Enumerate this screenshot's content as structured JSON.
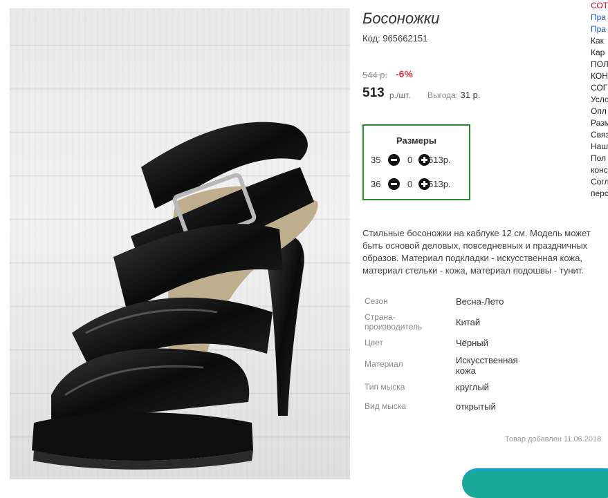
{
  "product": {
    "title": "Босоножки",
    "code_label": "Код: 965662151",
    "old_price": "544 р.",
    "discount": "-6%",
    "price": "513",
    "price_unit": "р./шт.",
    "saving_label": "Выгода:",
    "saving_value": "31 р."
  },
  "sizes": {
    "title": "Размеры",
    "rows": [
      {
        "size": "35",
        "qty": "0",
        "subtotal": "513р."
      },
      {
        "size": "36",
        "qty": "0",
        "subtotal": "513р."
      }
    ]
  },
  "description": [
    "Стильные босоножки на каблуке 12 см. Модель может",
    "быть основой деловых, повседневных и праздничных",
    "образов. Материал подкладки - искусственная кожа,",
    "материал стельки - кожа, материал подошвы - тунит."
  ],
  "attributes": [
    {
      "label": "Сезон",
      "value": "Весна-Лето"
    },
    {
      "label": "Страна-производитель",
      "value": "Китай"
    },
    {
      "label": "Цвет",
      "value": "Чёрный"
    },
    {
      "label": "Материал",
      "value": "Искусственная кожа"
    },
    {
      "label": "Тип мыска",
      "value": "круглый"
    },
    {
      "label": "Вид мыска",
      "value": "открытый"
    }
  ],
  "added_text": "Товар добавлен 11.06.2018",
  "side_links": [
    "СОТ",
    "Пра",
    "Пра",
    "Как",
    "Кар",
    "ПОЛ",
    "КОН",
    "СОГ",
    "Усло",
    "Опл",
    "Разм",
    "Связ",
    "Наш",
    "Пол",
    "конс",
    "Согл",
    "перс"
  ],
  "colors": {
    "accent_red": "#e0334b",
    "sizes_border": "#2c8a2c",
    "cta_teal": "#1aa89a"
  },
  "icons": {
    "minus": "minus-circle-icon",
    "plus": "plus-circle-icon"
  }
}
